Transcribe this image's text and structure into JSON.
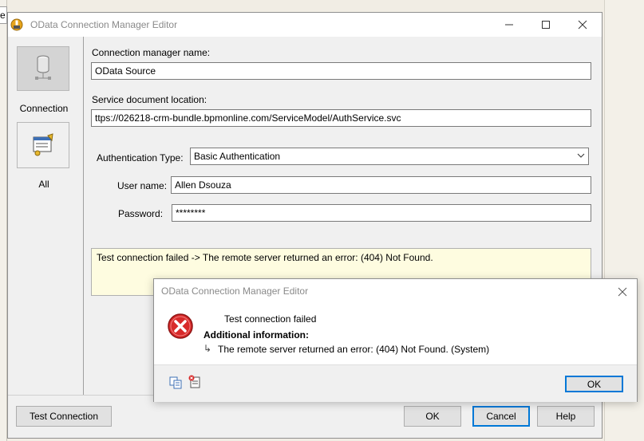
{
  "background": {
    "tab_char": "e"
  },
  "window": {
    "title": "OData Connection Manager Editor",
    "sidebar": [
      {
        "label": "Connection",
        "icon": "database-icon",
        "selected": true
      },
      {
        "label": "All",
        "icon": "properties-icon",
        "selected": false
      }
    ],
    "form": {
      "name_label": "Connection manager name:",
      "name_value": "OData Source",
      "location_label": "Service document location:",
      "location_value": "ttps://026218-crm-bundle.bpmonline.com/ServiceModel/AuthService.svc",
      "auth_label": "Authentication Type:",
      "auth_value": "Basic Authentication",
      "user_label": "User name:",
      "user_value": "Allen Dsouza",
      "password_label": "Password:",
      "password_value": "********",
      "result_message": "Test connection failed -> The remote server returned an error: (404) Not Found."
    },
    "buttons": {
      "test": "Test Connection",
      "ok": "OK",
      "cancel": "Cancel",
      "help": "Help"
    }
  },
  "dialog": {
    "title": "OData Connection Manager Editor",
    "main_text": "Test connection failed",
    "additional_label": "Additional information:",
    "detail_arrow": "↳",
    "detail_text": "The remote server returned an error: (404) Not Found. (System)",
    "ok_label": "OK"
  },
  "colors": {
    "error_red": "#d82a2a",
    "message_bg": "#fefce0",
    "accent": "#0078d7"
  }
}
